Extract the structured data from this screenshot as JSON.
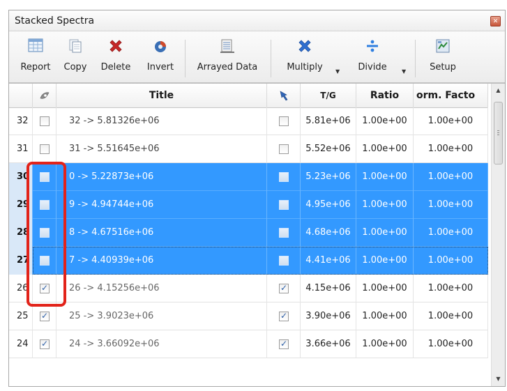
{
  "window": {
    "title": "Stacked Spectra"
  },
  "toolbar": {
    "report": "Report",
    "copy": "Copy",
    "delete": "Delete",
    "invert": "Invert",
    "arrayed": "Arrayed Data",
    "multiply": "Multiply",
    "divide": "Divide",
    "setup": "Setup"
  },
  "columns": {
    "title": "Title",
    "tg": "T/G",
    "ratio": "Ratio",
    "norm": "orm. Facto"
  },
  "rows": [
    {
      "num": "32",
      "title": "32 -> 5.81326e+06",
      "tg": "5.81e+06",
      "ratio": "1.00e+00",
      "norm": "1.00e+00",
      "checked": false,
      "selected": false
    },
    {
      "num": "31",
      "title": "31 -> 5.51645e+06",
      "tg": "5.52e+06",
      "ratio": "1.00e+00",
      "norm": "1.00e+00",
      "checked": false,
      "selected": false
    },
    {
      "num": "30",
      "title": "0 -> 5.22873e+06",
      "tg": "5.23e+06",
      "ratio": "1.00e+00",
      "norm": "1.00e+00",
      "checked": false,
      "selected": true
    },
    {
      "num": "29",
      "title": "9 -> 4.94744e+06",
      "tg": "4.95e+06",
      "ratio": "1.00e+00",
      "norm": "1.00e+00",
      "checked": false,
      "selected": true
    },
    {
      "num": "28",
      "title": "8 -> 4.67516e+06",
      "tg": "4.68e+06",
      "ratio": "1.00e+00",
      "norm": "1.00e+00",
      "checked": false,
      "selected": true
    },
    {
      "num": "27",
      "title": "7 -> 4.40939e+06",
      "tg": "4.41e+06",
      "ratio": "1.00e+00",
      "norm": "1.00e+00",
      "checked": false,
      "selected": true
    },
    {
      "num": "26",
      "title": "26 -> 4.15256e+06",
      "tg": "4.15e+06",
      "ratio": "1.00e+00",
      "norm": "1.00e+00",
      "checked": true,
      "selected": false
    },
    {
      "num": "25",
      "title": "25 -> 3.9023e+06",
      "tg": "3.90e+06",
      "ratio": "1.00e+00",
      "norm": "1.00e+00",
      "checked": true,
      "selected": false
    },
    {
      "num": "24",
      "title": "24 -> 3.66092e+06",
      "tg": "3.66e+06",
      "ratio": "1.00e+00",
      "norm": "1.00e+00",
      "checked": true,
      "selected": false
    }
  ],
  "colors": {
    "selection": "#3399ff",
    "highlight_box": "#e2231a",
    "delete_icon": "#c62828",
    "multiply_icon": "#2f6fd0"
  }
}
